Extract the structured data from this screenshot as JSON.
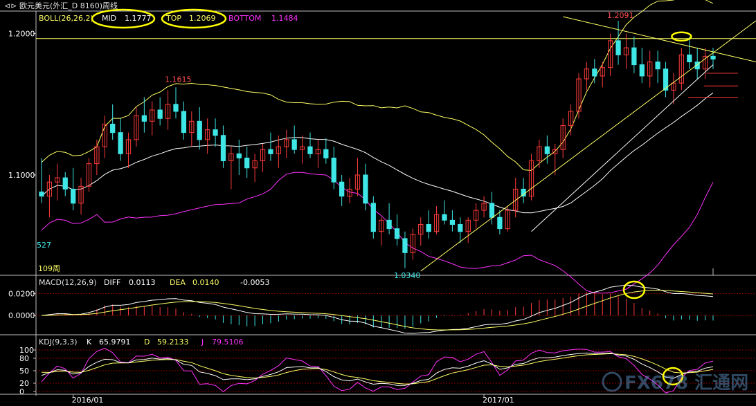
{
  "window": {
    "title": "欧元美元(外汇_D 8160)周线"
  },
  "colors": {
    "background": "#000000",
    "up": "#ff3b3b",
    "down": "#3ee6e6",
    "yellow": "#ffff66",
    "magenta": "#ff33ff",
    "white": "#ffffff",
    "axis": "#c0c0c0",
    "grid": "#8b0000",
    "highlight": "#ffff00"
  },
  "main_panel": {
    "header": {
      "indicator": "BOLL(26,26,2)",
      "mid_label": "MID",
      "mid_value": "1.1777",
      "top_label": "TOP",
      "top_value": "1.2069",
      "bottom_label": "BOTTOM",
      "bottom_value": "1.1484"
    },
    "y_ticks": [
      {
        "value": 1.2,
        "label": "1.2000"
      },
      {
        "value": 1.1,
        "label": "1.1000"
      }
    ],
    "horizontal_level": 1.1965,
    "annotations": {
      "high1": "1.1615",
      "low": "1.0340",
      "high2": "1.2091",
      "left_count": "527",
      "period_count": "109周"
    }
  },
  "macd_panel": {
    "indicator": "MACD(12,26,9)",
    "diff_label": "DIFF",
    "diff_value": "0.0113",
    "dea_label": "DEA",
    "dea_value": "0.0140",
    "macd_value": "-0.0053",
    "y_ticks": [
      {
        "value": 0.02,
        "label": "0.0200"
      },
      {
        "value": 0.0,
        "label": "0.0000"
      }
    ]
  },
  "kdj_panel": {
    "indicator": "KDJ(9,3,3)",
    "k_label": "K",
    "k_value": "65.9791",
    "d_label": "D",
    "d_value": "59.2133",
    "j_label": "J",
    "j_value": "79.5106",
    "y_ticks": [
      {
        "value": 100,
        "label": "100"
      },
      {
        "value": 80,
        "label": "80"
      },
      {
        "value": 50,
        "label": "50"
      },
      {
        "value": 20,
        "label": "20"
      },
      {
        "value": 0,
        "label": "0"
      }
    ]
  },
  "x_axis": {
    "labels": [
      {
        "index": 4,
        "label": "2016/01"
      },
      {
        "index": 56,
        "label": "2017/01"
      }
    ]
  },
  "watermark": {
    "text": "FX678 汇通网"
  },
  "chart_data": {
    "type": "candlestick",
    "period": "weekly",
    "ylim": [
      1.03,
      1.215
    ],
    "candles": [
      [
        1.088,
        1.112,
        1.08,
        1.085
      ],
      [
        1.085,
        1.1,
        1.07,
        1.095
      ],
      [
        1.095,
        1.108,
        1.082,
        1.098
      ],
      [
        1.098,
        1.102,
        1.085,
        1.09
      ],
      [
        1.09,
        1.105,
        1.075,
        1.08
      ],
      [
        1.08,
        1.098,
        1.072,
        1.092
      ],
      [
        1.092,
        1.112,
        1.088,
        1.108
      ],
      [
        1.108,
        1.125,
        1.1,
        1.12
      ],
      [
        1.12,
        1.142,
        1.112,
        1.136
      ],
      [
        1.136,
        1.15,
        1.125,
        1.13
      ],
      [
        1.13,
        1.14,
        1.11,
        1.115
      ],
      [
        1.115,
        1.13,
        1.105,
        1.125
      ],
      [
        1.125,
        1.148,
        1.12,
        1.142
      ],
      [
        1.142,
        1.155,
        1.13,
        1.138
      ],
      [
        1.138,
        1.152,
        1.128,
        1.146
      ],
      [
        1.146,
        1.155,
        1.135,
        1.14
      ],
      [
        1.14,
        1.16,
        1.132,
        1.15
      ],
      [
        1.15,
        1.162,
        1.14,
        1.145
      ],
      [
        1.145,
        1.152,
        1.125,
        1.13
      ],
      [
        1.13,
        1.145,
        1.12,
        1.138
      ],
      [
        1.138,
        1.148,
        1.118,
        1.125
      ],
      [
        1.125,
        1.14,
        1.115,
        1.132
      ],
      [
        1.132,
        1.14,
        1.12,
        1.128
      ],
      [
        1.128,
        1.135,
        1.105,
        1.11
      ],
      [
        1.11,
        1.12,
        1.09,
        1.115
      ],
      [
        1.115,
        1.125,
        1.1,
        1.112
      ],
      [
        1.112,
        1.12,
        1.098,
        1.105
      ],
      [
        1.105,
        1.115,
        1.095,
        1.11
      ],
      [
        1.11,
        1.122,
        1.102,
        1.118
      ],
      [
        1.118,
        1.13,
        1.11,
        1.115
      ],
      [
        1.115,
        1.128,
        1.105,
        1.12
      ],
      [
        1.12,
        1.132,
        1.112,
        1.125
      ],
      [
        1.125,
        1.135,
        1.115,
        1.118
      ],
      [
        1.118,
        1.128,
        1.108,
        1.12
      ],
      [
        1.12,
        1.13,
        1.112,
        1.115
      ],
      [
        1.115,
        1.125,
        1.105,
        1.118
      ],
      [
        1.118,
        1.126,
        1.108,
        1.112
      ],
      [
        1.112,
        1.12,
        1.09,
        1.095
      ],
      [
        1.095,
        1.1,
        1.078,
        1.085
      ],
      [
        1.085,
        1.098,
        1.08,
        1.09
      ],
      [
        1.09,
        1.112,
        1.085,
        1.1
      ],
      [
        1.1,
        1.108,
        1.075,
        1.08
      ],
      [
        1.08,
        1.085,
        1.055,
        1.06
      ],
      [
        1.06,
        1.07,
        1.05,
        1.068
      ],
      [
        1.068,
        1.08,
        1.058,
        1.062
      ],
      [
        1.062,
        1.072,
        1.05,
        1.055
      ],
      [
        1.055,
        1.06,
        1.034,
        1.045
      ],
      [
        1.045,
        1.062,
        1.04,
        1.058
      ],
      [
        1.058,
        1.07,
        1.05,
        1.065
      ],
      [
        1.065,
        1.075,
        1.055,
        1.06
      ],
      [
        1.06,
        1.078,
        1.058,
        1.072
      ],
      [
        1.072,
        1.082,
        1.065,
        1.068
      ],
      [
        1.068,
        1.075,
        1.06,
        1.065
      ],
      [
        1.065,
        1.07,
        1.052,
        1.06
      ],
      [
        1.06,
        1.07,
        1.052,
        1.068
      ],
      [
        1.068,
        1.08,
        1.062,
        1.075
      ],
      [
        1.075,
        1.085,
        1.07,
        1.08
      ],
      [
        1.08,
        1.088,
        1.065,
        1.07
      ],
      [
        1.07,
        1.075,
        1.058,
        1.062
      ],
      [
        1.062,
        1.078,
        1.06,
        1.075
      ],
      [
        1.075,
        1.098,
        1.07,
        1.09
      ],
      [
        1.09,
        1.098,
        1.08,
        1.085
      ],
      [
        1.085,
        1.115,
        1.082,
        1.11
      ],
      [
        1.11,
        1.125,
        1.105,
        1.12
      ],
      [
        1.12,
        1.128,
        1.108,
        1.115
      ],
      [
        1.115,
        1.122,
        1.1,
        1.118
      ],
      [
        1.118,
        1.14,
        1.112,
        1.135
      ],
      [
        1.135,
        1.15,
        1.128,
        1.145
      ],
      [
        1.145,
        1.172,
        1.14,
        1.168
      ],
      [
        1.168,
        1.18,
        1.16,
        1.175
      ],
      [
        1.175,
        1.182,
        1.165,
        1.17
      ],
      [
        1.17,
        1.18,
        1.162,
        1.176
      ],
      [
        1.176,
        1.2,
        1.17,
        1.195
      ],
      [
        1.195,
        1.2091,
        1.178,
        1.185
      ],
      [
        1.185,
        1.2,
        1.175,
        1.19
      ],
      [
        1.19,
        1.198,
        1.172,
        1.178
      ],
      [
        1.178,
        1.19,
        1.165,
        1.17
      ],
      [
        1.17,
        1.188,
        1.162,
        1.18
      ],
      [
        1.18,
        1.188,
        1.165,
        1.175
      ],
      [
        1.175,
        1.18,
        1.155,
        1.16
      ],
      [
        1.16,
        1.172,
        1.15,
        1.165
      ],
      [
        1.165,
        1.19,
        1.16,
        1.185
      ],
      [
        1.185,
        1.198,
        1.175,
        1.18
      ],
      [
        1.18,
        1.19,
        1.168,
        1.175
      ],
      [
        1.175,
        1.19,
        1.168,
        1.184
      ],
      [
        1.184,
        1.19,
        1.175,
        1.182
      ]
    ]
  }
}
